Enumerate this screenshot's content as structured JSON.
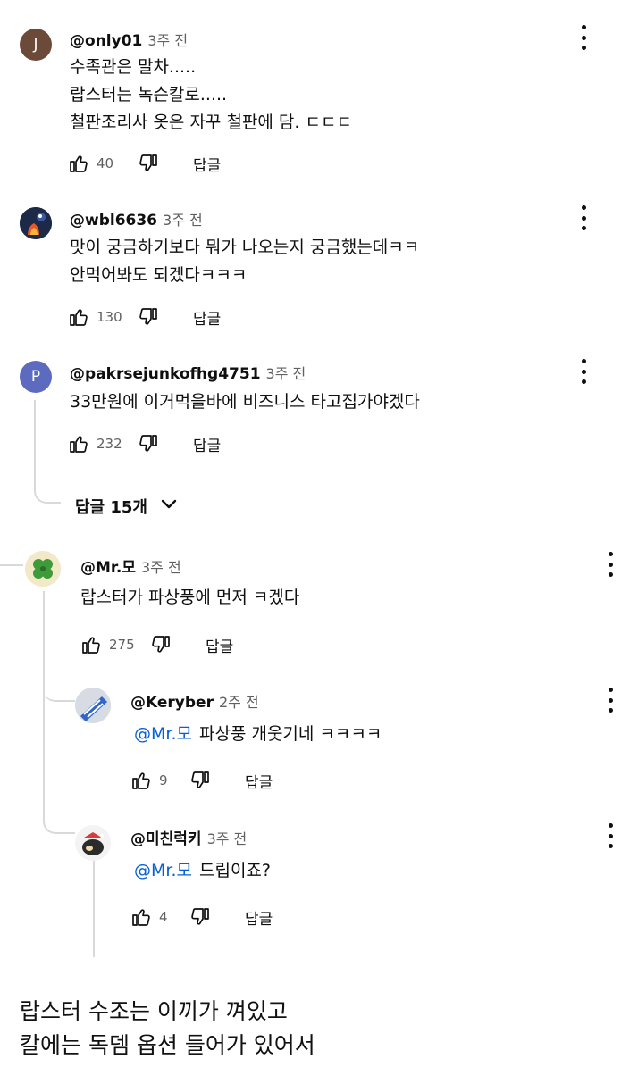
{
  "comments": [
    {
      "author": "@only01",
      "time": "3주 전",
      "avatar_letter": "J",
      "avatar_color": "#6b4a3a",
      "lines": [
        "수족관은 말차.....",
        "랍스터는 녹슨칼로.....",
        "철판조리사 옷은 자꾸 철판에 담. ㄷㄷㄷ"
      ],
      "likes": "40",
      "reply_label": "답글"
    },
    {
      "author": "@wbl6636",
      "time": "3주 전",
      "lines": [
        "맛이 궁금하기보다 뭐가 나오는지 궁금했는데ㅋㅋ",
        "안먹어봐도 되겠다ㅋㅋㅋ"
      ],
      "likes": "130",
      "reply_label": "답글"
    },
    {
      "author": "@pakrsejunkofhg4751",
      "time": "3주 전",
      "avatar_letter": "P",
      "avatar_color": "#5c6bc0",
      "lines": [
        "33만원에 이거먹을바에 비즈니스 타고집가야겠다"
      ],
      "likes": "232",
      "reply_label": "답글"
    }
  ],
  "replies_toggle": "답글 15개",
  "replies": [
    {
      "author": "@Mr.모",
      "time": "3주 전",
      "text": "랍스터가 파상풍에 먼저 ㅋ겠다",
      "likes": "275",
      "reply_label": "답글"
    },
    {
      "author": "@Keryber",
      "time": "2주 전",
      "mention": "@Mr.모",
      "text": "파상풍 개웃기네 ㅋㅋㅋㅋ",
      "likes": "9",
      "reply_label": "답글"
    },
    {
      "author": "@미친럭키",
      "time": "3주 전",
      "mention": "@Mr.모",
      "text": "드립이죠?",
      "likes": "4",
      "reply_label": "답글"
    }
  ],
  "caption": [
    "랍스터 수조는 이끼가 껴있고",
    "칼에는 독뎀 옵션 들어가 있어서"
  ],
  "colors": {
    "mention": "#065fd4",
    "meta": "#606060",
    "thread_line": "#d9d9d9"
  },
  "icons": [
    "like-icon",
    "dislike-icon",
    "more-vert-icon",
    "chevron-down-icon"
  ]
}
